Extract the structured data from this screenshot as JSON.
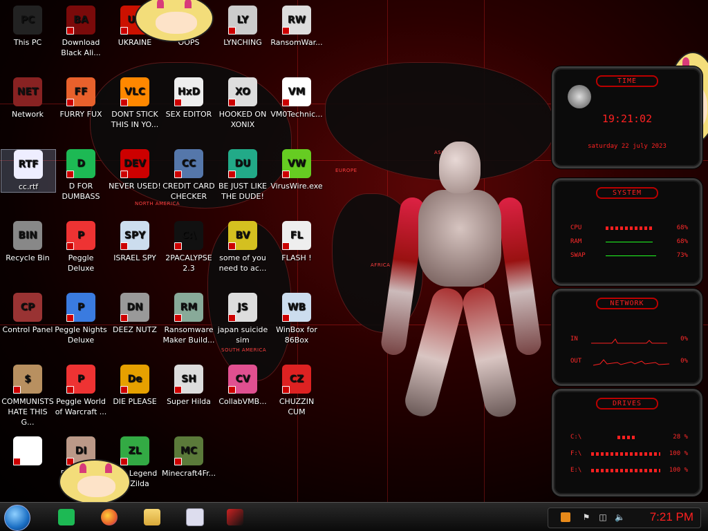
{
  "desktop": {
    "icons": [
      {
        "label": "This PC"
      },
      {
        "label": "Download Black Ali..."
      },
      {
        "label": "UKRAINE"
      },
      {
        "label": "OOPS"
      },
      {
        "label": "LYNCHING"
      },
      {
        "label": "RansomWar..."
      },
      {
        "label": "Network"
      },
      {
        "label": "FURRY FUX"
      },
      {
        "label": "DONT STICK THIS IN YO..."
      },
      {
        "label": "SEX EDITOR"
      },
      {
        "label": "HOOKED ON XONIX"
      },
      {
        "label": "VM0Technic..."
      },
      {
        "label": "cc.rtf"
      },
      {
        "label": "D FOR DUMBASS"
      },
      {
        "label": "NEVER USED!"
      },
      {
        "label": "CREDIT CARD CHECKER"
      },
      {
        "label": "BE JUST LIKE THE DUDE!"
      },
      {
        "label": "VirusWire.exe"
      },
      {
        "label": "Recycle Bin"
      },
      {
        "label": "Peggle Deluxe"
      },
      {
        "label": "ISRAEL SPY"
      },
      {
        "label": "2PACALYPSE 2.3"
      },
      {
        "label": "some of you need to ac..."
      },
      {
        "label": "FLASH !"
      },
      {
        "label": "Control Panel"
      },
      {
        "label": "Peggle Nights Deluxe"
      },
      {
        "label": "DEEZ NUTZ"
      },
      {
        "label": "Ransomware Maker Build..."
      },
      {
        "label": "japan suicide sim"
      },
      {
        "label": "WinBox for 86Box"
      },
      {
        "label": "COMMUNISTS HATE THIS G..."
      },
      {
        "label": "Peggle World of Warcraft ..."
      },
      {
        "label": "DIE PLEASE"
      },
      {
        "label": "Super Hilda"
      },
      {
        "label": "CollabVMB..."
      },
      {
        "label": "CHUZZIN CUM"
      },
      {
        "label": ""
      },
      {
        "label": "DID I THAT"
      },
      {
        "label": "The Legend of Zilda"
      },
      {
        "label": "Minecraft4Fr..."
      }
    ],
    "glyphs": [
      "PC",
      "BA",
      "UA",
      "!!",
      "LY",
      "RW",
      "NET",
      "FF",
      "VLC",
      "HxD",
      "XO",
      "VM",
      "RTF",
      "D",
      "DEV",
      "CC",
      "DU",
      "VW",
      "BIN",
      "P",
      "SPY",
      "C:\\",
      "BV",
      "FL",
      "CP",
      "P",
      "DN",
      "RM",
      "JS",
      "WB",
      "$",
      "P",
      "De",
      "SH",
      "CV",
      "CZ",
      "",
      "DI",
      "ZL",
      "MC"
    ],
    "glyph_colors": [
      "#222",
      "#7a0a0a",
      "#c10",
      "#d33",
      "#ccc",
      "#ddd",
      "#822",
      "#e8612c",
      "#f80",
      "#eee",
      "#ddd",
      "#fff",
      "#eef",
      "#1db954",
      "#c00",
      "#5577aa",
      "#2a8",
      "#6c2",
      "#888",
      "#e33",
      "#cde",
      "#111",
      "#d4c020",
      "#eee",
      "#933",
      "#3a7be0",
      "#999",
      "#8a9",
      "#ddd",
      "#cde",
      "#b89060",
      "#e33",
      "#e6a000",
      "#ddd",
      "#e05090",
      "#d22",
      "#fff",
      "#b98",
      "#3a4",
      "#5b7a3a"
    ]
  },
  "map_labels": [
    "NORTH AMERICA",
    "EUROPE",
    "AFRICA",
    "SOUTH AMERICA",
    "ASIA"
  ],
  "widgets": {
    "time": {
      "title": "TIME",
      "clock": "19:21:02",
      "date": "saturday 22 july 2023"
    },
    "system": {
      "title": "SYSTEM",
      "rows": [
        {
          "label": "CPU",
          "value": "68%",
          "fraction": 0.68
        },
        {
          "label": "RAM",
          "value": "68%",
          "fraction": 0.68
        },
        {
          "label": "SWAP",
          "value": "73%",
          "fraction": 0.73
        }
      ]
    },
    "network": {
      "title": "NETWORK",
      "rows": [
        {
          "label": "IN",
          "value": "0%"
        },
        {
          "label": "OUT",
          "value": "0%"
        }
      ]
    },
    "drives": {
      "title": "DRIVES",
      "rows": [
        {
          "label": "C:\\",
          "value": "28 %",
          "fraction": 0.28
        },
        {
          "label": "F:\\",
          "value": "100 %",
          "fraction": 1.0
        },
        {
          "label": "E:\\",
          "value": "100 %",
          "fraction": 1.0
        }
      ]
    }
  },
  "taskbar": {
    "clock": "7:21 PM",
    "apps": [
      "dfd-app",
      "firefox",
      "file-explorer",
      "winbox",
      "control-panel"
    ],
    "tray_icons": [
      "app-tray-icon",
      "network-error-icon",
      "network-icon",
      "volume-icon"
    ]
  },
  "colors": {
    "accent": "#ff2020",
    "background": "#0a0000",
    "taskbar": "#111111"
  }
}
